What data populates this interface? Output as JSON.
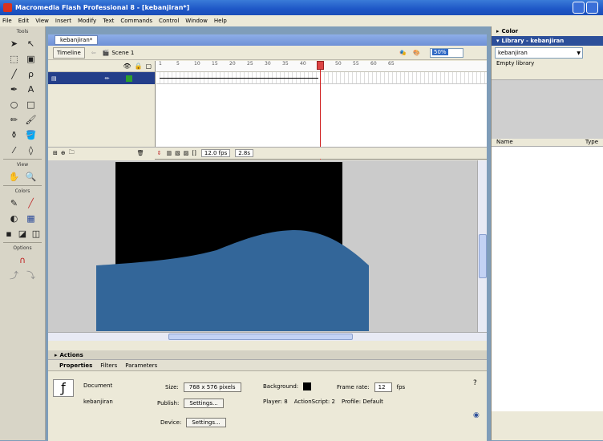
{
  "app": {
    "title": "Macromedia Flash Professional 8 - [kebanjiran*]"
  },
  "menu": [
    "File",
    "Edit",
    "View",
    "Insert",
    "Modify",
    "Text",
    "Commands",
    "Control",
    "Window",
    "Help"
  ],
  "tools": {
    "label": "Tools",
    "view_label": "View",
    "colors_label": "Colors",
    "options_label": "Options"
  },
  "document": {
    "tab": "kebanjiran*",
    "timeline_button": "Timeline",
    "scene": "Scene 1",
    "zoom": "50%"
  },
  "timeline": {
    "ruler": [
      "1",
      "5",
      "10",
      "15",
      "20",
      "25",
      "30",
      "35",
      "40",
      "45",
      "50",
      "55",
      "60",
      "65"
    ],
    "fps": "12.0 fps",
    "time": "2.8s"
  },
  "stage": {
    "background": "#000000",
    "wave_color": "#336699"
  },
  "actions_label": "Actions",
  "properties": {
    "tabs": [
      "Properties",
      "Filters",
      "Parameters"
    ],
    "doc_type": "Document",
    "doc_name": "kebanjiran",
    "size_label": "Size:",
    "size_value": "768 x 576 pixels",
    "background_label": "Background:",
    "framerate_label": "Frame rate:",
    "framerate_value": "12",
    "fps_label": "fps",
    "publish_label": "Publish:",
    "settings_btn": "Settings...",
    "player": "Player: 8",
    "actionscript": "ActionScript: 2",
    "profile": "Profile: Default",
    "device_label": "Device:",
    "device_btn": "Settings..."
  },
  "right_panel": {
    "color_label": "Color",
    "library_title": "Library - kebanjiran",
    "library_select": "kebanjiran",
    "empty_label": "Empty library",
    "col_name": "Name",
    "col_type": "Type"
  }
}
